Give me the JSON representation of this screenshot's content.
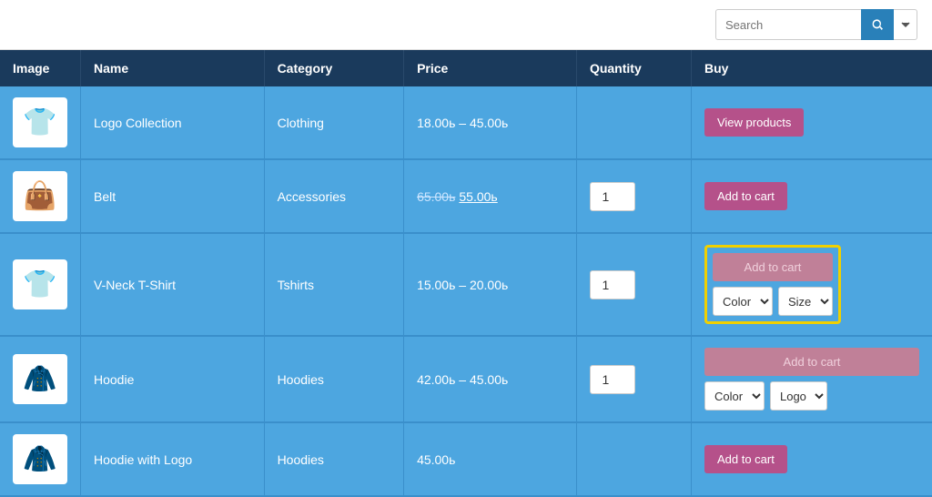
{
  "header": {
    "search_placeholder": "Search",
    "search_btn_label": "Search",
    "dropdown_btn_label": "▾"
  },
  "table": {
    "columns": [
      "Image",
      "Name",
      "Category",
      "Price",
      "Quantity",
      "Buy"
    ],
    "rows": [
      {
        "id": 1,
        "name": "Logo Collection",
        "category": "Clothing",
        "price_display": "18.00ь – 45.00ь",
        "price_original": null,
        "price_sale": null,
        "has_range": true,
        "quantity": null,
        "buy_type": "view",
        "buy_label": "View products",
        "highlight": false,
        "img_emoji": "👕"
      },
      {
        "id": 2,
        "name": "Belt",
        "category": "Accessories",
        "price_display": null,
        "price_original": "65.00ь",
        "price_sale": "55.00ь",
        "has_range": false,
        "quantity": "1",
        "buy_type": "add",
        "buy_label": "Add to cart",
        "highlight": false,
        "img_emoji": "👜"
      },
      {
        "id": 3,
        "name": "V-Neck T-Shirt",
        "category": "Tshirts",
        "price_display": "15.00ь – 20.00ь",
        "price_original": null,
        "price_sale": null,
        "has_range": true,
        "quantity": "1",
        "buy_type": "add_variant",
        "buy_label": "Add to cart",
        "highlight": true,
        "variant1_label": "Color",
        "variant2_label": "Size",
        "img_emoji": "👕"
      },
      {
        "id": 4,
        "name": "Hoodie",
        "category": "Hoodies",
        "price_display": "42.00ь – 45.00ь",
        "price_original": null,
        "price_sale": null,
        "has_range": true,
        "quantity": "1",
        "buy_type": "add_variant",
        "buy_label": "Add to cart",
        "highlight": false,
        "variant1_label": "Color",
        "variant2_label": "Logo",
        "img_emoji": "🧥"
      },
      {
        "id": 5,
        "name": "Hoodie with Logo",
        "category": "Hoodies",
        "price_display": "45.00ь",
        "price_original": null,
        "price_sale": null,
        "has_range": false,
        "quantity": null,
        "buy_type": "add",
        "buy_label": "Add to cart",
        "highlight": false,
        "img_emoji": "🧥"
      }
    ]
  }
}
